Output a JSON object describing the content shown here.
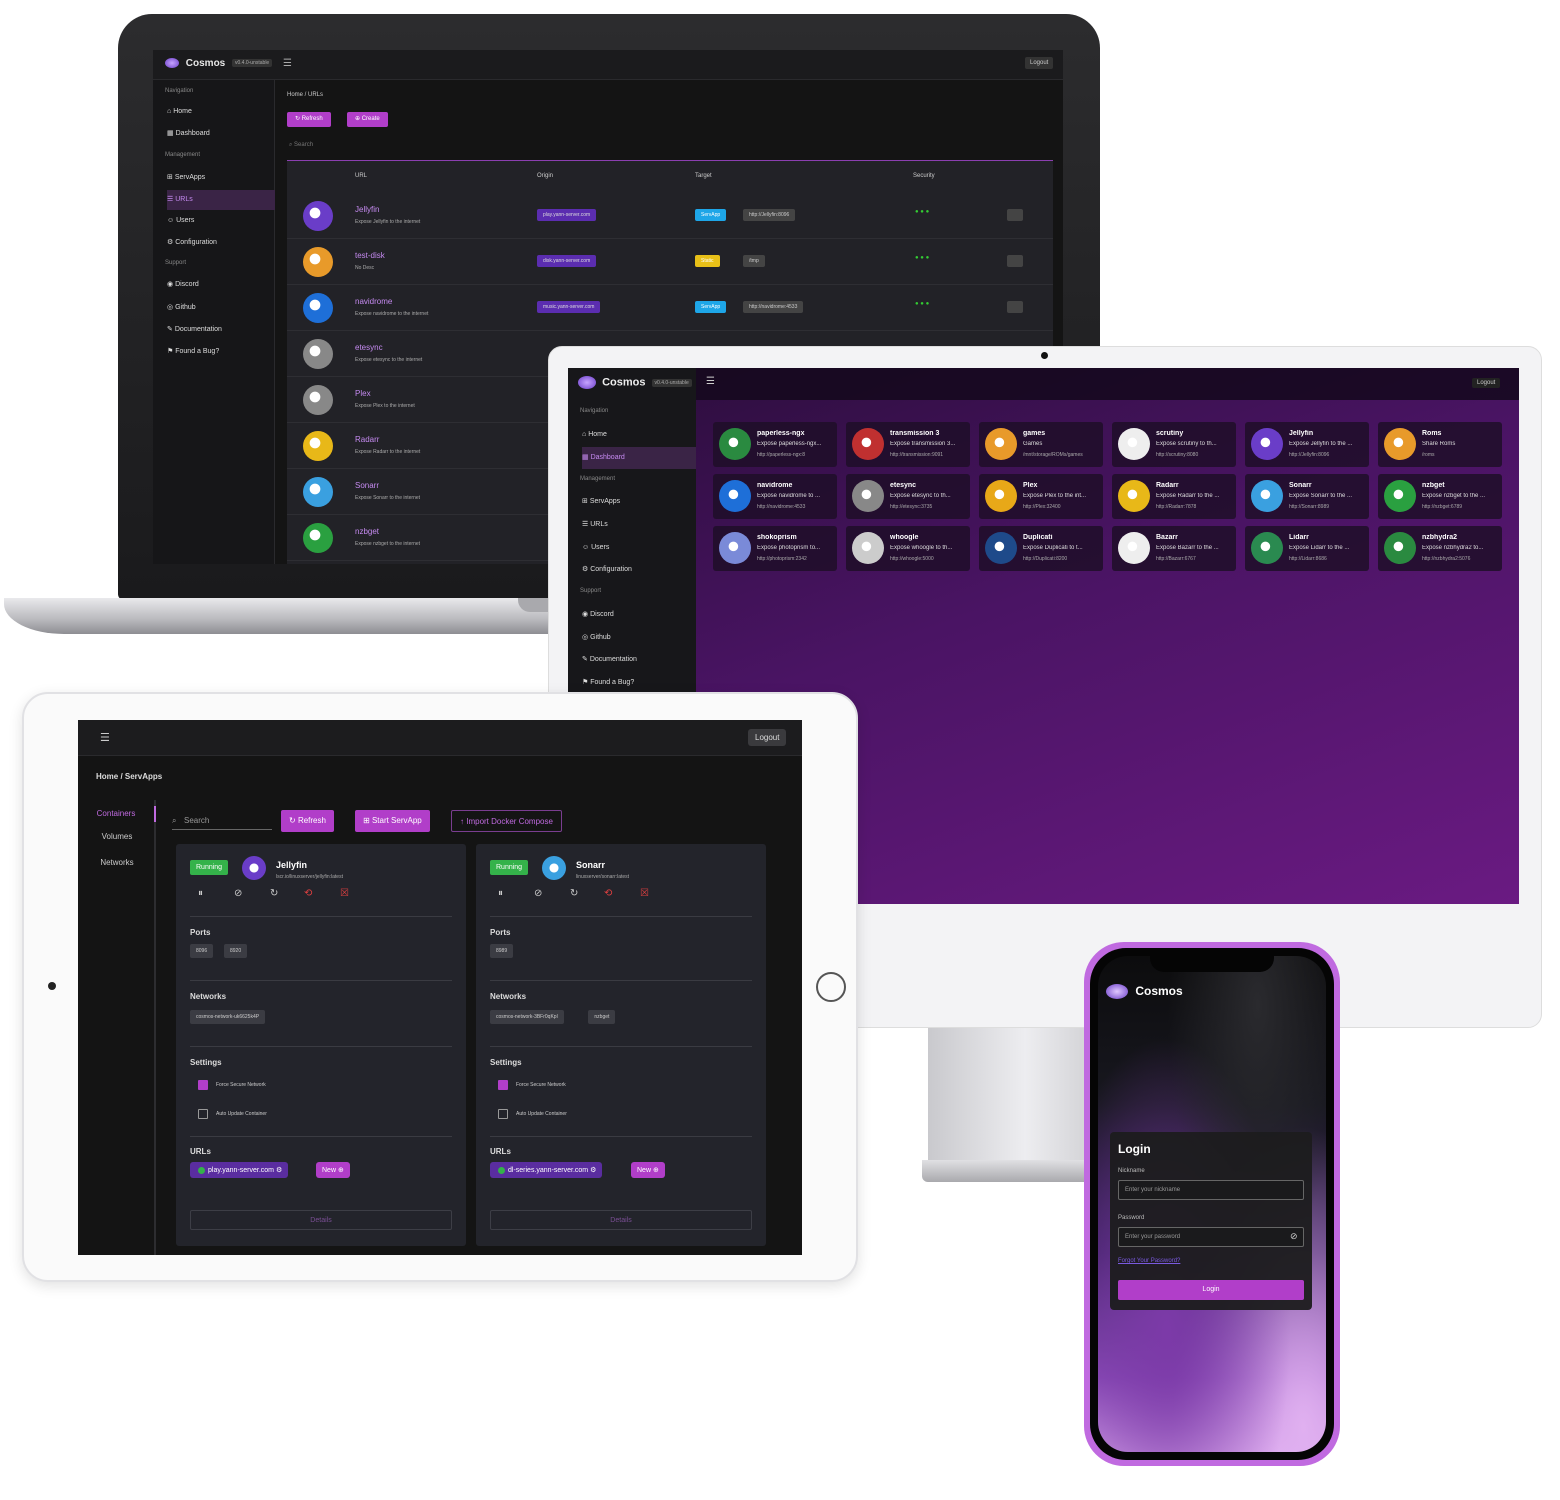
{
  "brand": {
    "name": "Cosmos",
    "version_badge": "v0.4.0-unstable"
  },
  "laptop": {
    "sidebar": {
      "groups": [
        "Navigation",
        "Management",
        "Support"
      ],
      "items": [
        "Home",
        "Dashboard",
        "ServApps",
        "URLs",
        "Users",
        "Configuration",
        "Discord",
        "Github",
        "Documentation",
        "Found a Bug?"
      ]
    },
    "logout": "Logout",
    "breadcrumb": "Home / URLs",
    "buttons": [
      "Refresh",
      "Create"
    ],
    "search_placeholder": "Search",
    "columns": [
      "URL",
      "Origin",
      "Target",
      "Security"
    ],
    "rows": [
      {
        "name": "Jellyfin",
        "desc": "Expose Jellyfin to the internet",
        "origin": "play.yann-server.com",
        "target_type": "ServApp",
        "target": "http://Jellyfin:8096",
        "color": "#6a3dc8"
      },
      {
        "name": "test-disk",
        "desc": "No Desc",
        "origin": "disk.yann-server.com",
        "target_type": "Static",
        "target": "/tmp",
        "color": "#e89a2a"
      },
      {
        "name": "navidrome",
        "desc": "Expose navidrome to the internet",
        "origin": "music.yann-server.com",
        "target_type": "ServApp",
        "target": "http://navidrome:4533",
        "color": "#1e6fd8"
      },
      {
        "name": "etesync",
        "desc": "Expose etesync to the internet",
        "origin": "",
        "target_type": "",
        "target": "",
        "color": "#888888"
      },
      {
        "name": "Plex",
        "desc": "Expose Plex to the internet",
        "origin": "",
        "target_type": "",
        "target": "",
        "color": "#888888"
      },
      {
        "name": "Radarr",
        "desc": "Expose Radarr to the internet",
        "origin": "",
        "target_type": "",
        "target": "",
        "color": "#e8b818"
      },
      {
        "name": "Sonarr",
        "desc": "Expose Sonarr to the internet",
        "origin": "",
        "target_type": "",
        "target": "",
        "color": "#3aa0e0"
      },
      {
        "name": "nzbget",
        "desc": "Expose nzbget to the internet",
        "origin": "",
        "target_type": "",
        "target": "",
        "color": "#2aa040"
      }
    ]
  },
  "monitor": {
    "logout": "Logout",
    "sidebar": {
      "groups": [
        "Navigation",
        "Management",
        "Support"
      ],
      "items": [
        "Home",
        "Dashboard",
        "ServApps",
        "URLs",
        "Users",
        "Configuration",
        "Discord",
        "Github",
        "Documentation",
        "Found a Bug?"
      ]
    },
    "apps": [
      {
        "t": "paperless-ngx",
        "d": "Expose paperless-ngx...",
        "u": "http://paperless-ngx:8",
        "c": "#2a8a40"
      },
      {
        "t": "transmission 3",
        "d": "Expose transmission 3...",
        "u": "http://transmission:9091",
        "c": "#c03030"
      },
      {
        "t": "games",
        "d": "Games",
        "u": "/mnt/storage/ROMs/games",
        "c": "#e89a2a"
      },
      {
        "t": "scrutiny",
        "d": "Expose scrutiny to th...",
        "u": "http://scrutiny:8080",
        "c": "#eeeeee"
      },
      {
        "t": "Jellyfin",
        "d": "Expose Jellyfin to the ...",
        "u": "http://Jellyfin:8096",
        "c": "#6a3dc8"
      },
      {
        "t": "Roms",
        "d": "Share Roms",
        "u": "/roms",
        "c": "#e89a2a"
      },
      {
        "t": "navidrome",
        "d": "Expose navidrome to ...",
        "u": "http://navidrome:4533",
        "c": "#1e6fd8"
      },
      {
        "t": "etesync",
        "d": "Expose etesync to th...",
        "u": "http://etesync:3735",
        "c": "#888888"
      },
      {
        "t": "Plex",
        "d": "Expose Plex to the int...",
        "u": "http://Plex:32400",
        "c": "#e8a818"
      },
      {
        "t": "Radarr",
        "d": "Expose Radarr to the ...",
        "u": "http://Radarr:7878",
        "c": "#e8b818"
      },
      {
        "t": "Sonarr",
        "d": "Expose Sonarr to the ...",
        "u": "http://Sonarr:8989",
        "c": "#3aa0e0"
      },
      {
        "t": "nzbget",
        "d": "Expose nzbget to the ...",
        "u": "http://nzbget:6789",
        "c": "#2aa040"
      },
      {
        "t": "shokoprism",
        "d": "Expose photoprism to...",
        "u": "http://photoprism:2342",
        "c": "#7a8ad8"
      },
      {
        "t": "whoogle",
        "d": "Expose whoogle to th...",
        "u": "http://whoogle:5000",
        "c": "#cccccc"
      },
      {
        "t": "Duplicati",
        "d": "Expose Duplicati to t...",
        "u": "http://Duplicati:8200",
        "c": "#1e4a8a"
      },
      {
        "t": "Bazarr",
        "d": "Expose Bazarr to the ...",
        "u": "http://Bazarr:6767",
        "c": "#eeeeee"
      },
      {
        "t": "Lidarr",
        "d": "Expose Lidarr to the ...",
        "u": "http://Lidarr:8686",
        "c": "#2a8a50"
      },
      {
        "t": "nzbhydra2",
        "d": "Expose nzbhydra2 to...",
        "u": "http://nzbhydra2:5076",
        "c": "#2a8a40"
      }
    ]
  },
  "tablet": {
    "logout": "Logout",
    "breadcrumb": "Home / ServApps",
    "nav": [
      "Containers",
      "Volumes",
      "Networks"
    ],
    "search_placeholder": "Search",
    "buttons": [
      "Refresh",
      "Start ServApp",
      "Import Docker Compose"
    ],
    "cards": [
      {
        "status": "Running",
        "name": "Jellyfin",
        "image": "lscr.io/linuxserver/jellyfin:latest",
        "ports": [
          "8096",
          "8920"
        ],
        "networks": [
          "cosmos-network-uk6625k4P"
        ],
        "url": "play.yann-server.com",
        "color": "#6a3dc8"
      },
      {
        "status": "Running",
        "name": "Sonarr",
        "image": "linuxserver/sonarr:latest",
        "ports": [
          "8989"
        ],
        "networks": [
          "cosmos-network-3BFr0qKpl",
          "nzbget"
        ],
        "url": "dl-series.yann-server.com",
        "color": "#3aa0e0"
      }
    ],
    "labels": {
      "ports": "Ports",
      "networks": "Networks",
      "settings": "Settings",
      "urls": "URLs",
      "force_secure": "Force Secure Network",
      "auto_update": "Auto Update Container",
      "new": "New",
      "details": "Details"
    }
  },
  "phone": {
    "title": "Login",
    "nickname_label": "Nickname",
    "nickname_placeholder": "Enter your nickname",
    "password_label": "Password",
    "password_placeholder": "Enter your password",
    "forgot": "Forgot Your Password?",
    "login_button": "Login"
  }
}
